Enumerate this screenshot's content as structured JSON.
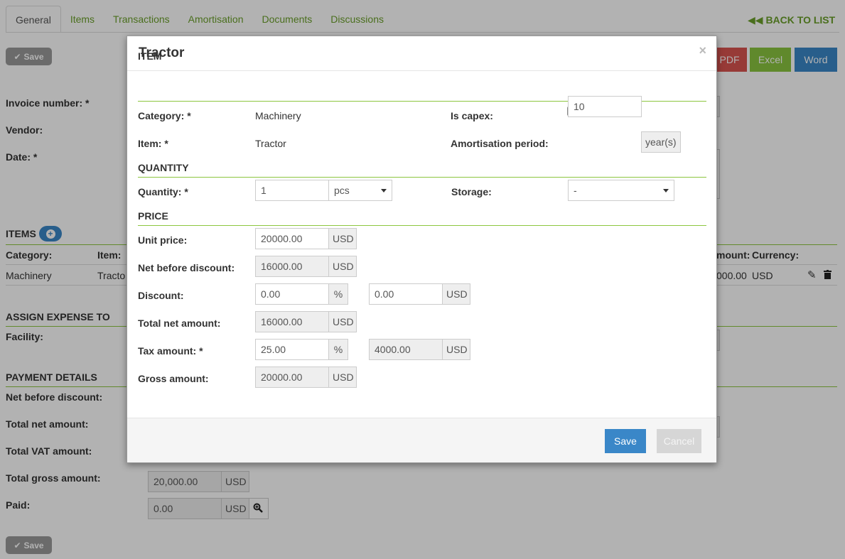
{
  "tabs": [
    {
      "label": "General",
      "active": true
    },
    {
      "label": "Items"
    },
    {
      "label": "Transactions"
    },
    {
      "label": "Amortisation"
    },
    {
      "label": "Documents"
    },
    {
      "label": "Discussions"
    }
  ],
  "back_to_list": "BACK TO LIST",
  "save_label": "Save",
  "exports": {
    "pdf": "PDF",
    "excel": "Excel",
    "word": "Word"
  },
  "form": {
    "invoice_number_label": "Invoice number: *",
    "vendor_label": "Vendor:",
    "date_label": "Date: *"
  },
  "items_section": {
    "title": "ITEMS",
    "headers": {
      "category": "Category:",
      "item": "Item:",
      "amount": "mount:",
      "currency": "Currency:"
    },
    "row": {
      "category": "Machinery",
      "item": "Tracto",
      "amount": "000.00",
      "currency": "USD"
    }
  },
  "assign": {
    "title": "ASSIGN EXPENSE TO",
    "facility_label": "Facility:"
  },
  "payment": {
    "title": "PAYMENT DETAILS",
    "net_before_discount_label": "Net before discount:",
    "total_net_label": "Total net amount:",
    "total_vat_label": "Total VAT amount:",
    "total_gross_label": "Total gross amount:",
    "total_gross_value": "20,000.00",
    "paid_label": "Paid:",
    "paid_value": "0.00",
    "currency": "USD"
  },
  "modal": {
    "title": "Tractor",
    "close": "×",
    "item_section": "ITEM",
    "category_label": "Category: *",
    "category_value": "Machinery",
    "is_capex_label": "Is capex:",
    "is_capex_checked": true,
    "item_label": "Item: *",
    "item_value": "Tractor",
    "amortisation_label": "Amortisation period:",
    "amortisation_value": "10",
    "amortisation_unit": "year(s)",
    "quantity_section": "QUANTITY",
    "quantity_label": "Quantity: *",
    "quantity_value": "1",
    "quantity_unit": "pcs",
    "storage_label": "Storage:",
    "storage_value": "-",
    "price_section": "PRICE",
    "unit_price_label": "Unit price:",
    "unit_price_value": "20000.00",
    "net_before_discount_label": "Net before discount:",
    "net_before_discount_value": "16000.00",
    "discount_label": "Discount:",
    "discount_percent": "0.00",
    "discount_amount": "0.00",
    "total_net_label": "Total net amount:",
    "total_net_value": "16000.00",
    "tax_label": "Tax amount: *",
    "tax_percent": "25.00",
    "tax_amount": "4000.00",
    "gross_label": "Gross amount:",
    "gross_value": "20000.00",
    "currency": "USD",
    "percent": "%",
    "save": "Save",
    "cancel": "Cancel"
  },
  "colors": {
    "accent_green": "#6a9f2a",
    "section_line": "#8dc63f",
    "primary_blue": "#3a87c8",
    "danger_red": "#d9534f",
    "success_green": "#8ac43f"
  }
}
